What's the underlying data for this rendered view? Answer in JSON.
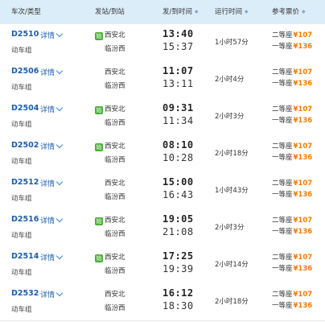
{
  "header": {
    "train_type": "车次/类型",
    "stations": "发站/到站",
    "times": "发/到时间",
    "duration": "运行时间",
    "price": "参考票价",
    "sort_glyph": "◆"
  },
  "trains": [
    {
      "number": "D2510",
      "detail_label": "详情",
      "type": "动车组",
      "from": "西安北",
      "to": "临汾西",
      "from_badge": "始",
      "dep": "13:40",
      "arr": "15:37",
      "duration": "1小时57分",
      "seat1_label": "二等座",
      "seat1_price": "¥107",
      "seat2_label": "一等座",
      "seat2_price": "¥136"
    },
    {
      "number": "D2506",
      "detail_label": "详情",
      "type": "动车组",
      "from": "西安北",
      "to": "临汾西",
      "from_badge": "",
      "dep": "11:07",
      "arr": "13:11",
      "duration": "2小时4分",
      "seat1_label": "二等座",
      "seat1_price": "¥107",
      "seat2_label": "一等座",
      "seat2_price": "¥136"
    },
    {
      "number": "D2504",
      "detail_label": "详情",
      "type": "动车组",
      "from": "西安北",
      "to": "临汾西",
      "from_badge": "始",
      "dep": "09:31",
      "arr": "11:34",
      "duration": "2小时3分",
      "seat1_label": "二等座",
      "seat1_price": "¥107",
      "seat2_label": "一等座",
      "seat2_price": "¥136"
    },
    {
      "number": "D2502",
      "detail_label": "详情",
      "type": "动车组",
      "from": "西安北",
      "to": "临汾西",
      "from_badge": "始",
      "dep": "08:10",
      "arr": "10:28",
      "duration": "2小时18分",
      "seat1_label": "二等座",
      "seat1_price": "¥107",
      "seat2_label": "一等座",
      "seat2_price": "¥136"
    },
    {
      "number": "D2512",
      "detail_label": "详情",
      "type": "动车组",
      "from": "西安北",
      "to": "临汾西",
      "from_badge": "",
      "dep": "15:00",
      "arr": "16:43",
      "duration": "1小时43分",
      "seat1_label": "二等座",
      "seat1_price": "¥107",
      "seat2_label": "一等座",
      "seat2_price": "¥136"
    },
    {
      "number": "D2516",
      "detail_label": "详情",
      "type": "动车组",
      "from": "西安北",
      "to": "临汾西",
      "from_badge": "始",
      "dep": "19:05",
      "arr": "21:08",
      "duration": "2小时3分",
      "seat1_label": "二等座",
      "seat1_price": "¥107",
      "seat2_label": "一等座",
      "seat2_price": "¥136"
    },
    {
      "number": "D2514",
      "detail_label": "详情",
      "type": "动车组",
      "from": "西安北",
      "to": "临汾西",
      "from_badge": "始",
      "dep": "17:25",
      "arr": "19:39",
      "duration": "2小时14分",
      "seat1_label": "二等座",
      "seat1_price": "¥107",
      "seat2_label": "一等座",
      "seat2_price": "¥136"
    },
    {
      "number": "D2532",
      "detail_label": "详情",
      "type": "动车组",
      "from": "西安北",
      "to": "临汾西",
      "from_badge": "",
      "dep": "16:12",
      "arr": "18:30",
      "duration": "2小时18分",
      "seat1_label": "二等座",
      "seat1_price": "¥107",
      "seat2_label": "一等座",
      "seat2_price": "¥136"
    }
  ],
  "colors": {
    "header_bg": "#dcedfa",
    "train_number": "#1c5ea8",
    "price": "#f27c00",
    "start_badge": "#4cae36"
  }
}
